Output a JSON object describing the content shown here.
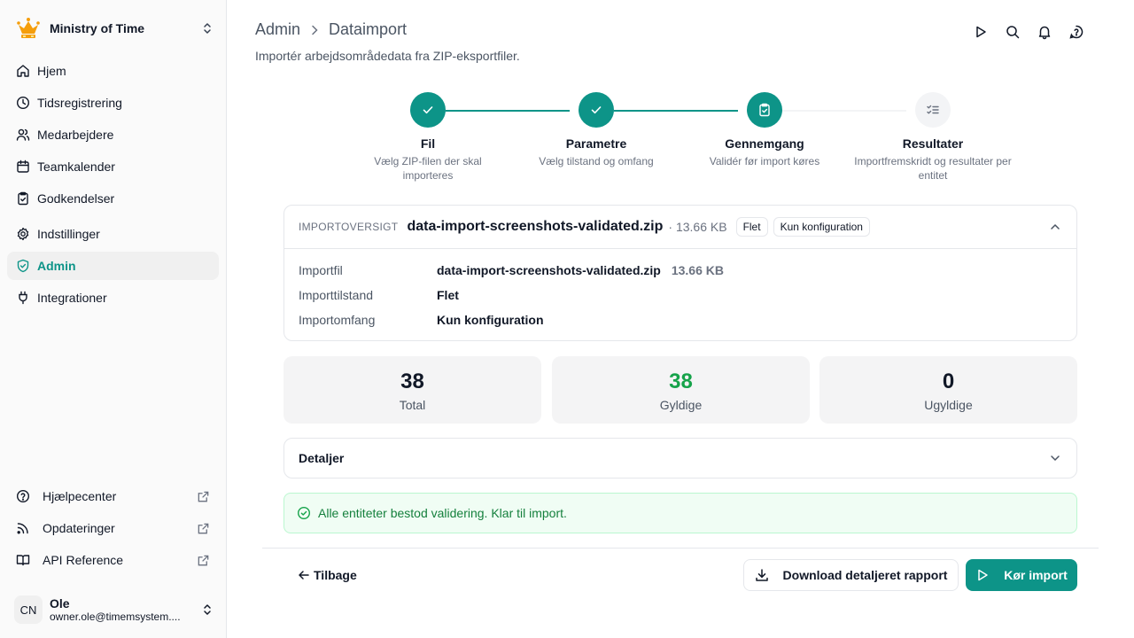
{
  "colors": {
    "accent": "#0d9488",
    "success": "#16a34a",
    "muted": "#6b7280",
    "inactive_step": "#f3f4f6"
  },
  "org": {
    "name": "Ministry of Time"
  },
  "nav": [
    {
      "label": "Hjem",
      "icon": "home-icon"
    },
    {
      "label": "Tidsregistrering",
      "icon": "clock-icon"
    },
    {
      "label": "Medarbejdere",
      "icon": "users-icon"
    },
    {
      "label": "Teamkalender",
      "icon": "calendar-icon"
    },
    {
      "label": "Godkendelser",
      "icon": "clipboard-check-icon"
    },
    {
      "label": "Indstillinger",
      "icon": "gear-icon"
    },
    {
      "label": "Admin",
      "icon": "shield-check-icon",
      "active": true
    },
    {
      "label": "Integrationer",
      "icon": "plug-icon"
    }
  ],
  "bottom_links": [
    {
      "label": "Hjælpecenter",
      "icon": "help-circle-icon"
    },
    {
      "label": "Opdateringer",
      "icon": "rss-icon"
    },
    {
      "label": "API Reference",
      "icon": "book-icon"
    }
  ],
  "user": {
    "initials": "CN",
    "name": "Ole",
    "email": "owner.ole@timemsystem...."
  },
  "breadcrumb": {
    "parent": "Admin",
    "current": "Dataimport"
  },
  "subtitle": "Importér arbejdsområdedata fra ZIP-eksportfiler.",
  "steps": [
    {
      "title": "Fil",
      "desc": "Vælg ZIP-filen der skal importeres",
      "state": "done"
    },
    {
      "title": "Parametre",
      "desc": "Vælg tilstand og omfang",
      "state": "done"
    },
    {
      "title": "Gennemgang",
      "desc": "Validér før import køres",
      "state": "current"
    },
    {
      "title": "Resultater",
      "desc": "Importfremskridt og resultater per entitet",
      "state": "pending"
    }
  ],
  "overview": {
    "caption": "IMPORTOVERSIGT",
    "file_name": "data-import-screenshots-validated.zip",
    "file_size_inline": "· 13.66 KB",
    "badge_mode": "Flet",
    "badge_scope": "Kun konfiguration",
    "rows": {
      "file_label": "Importfil",
      "file_value": "data-import-screenshots-validated.zip",
      "file_size": "13.66 KB",
      "mode_label": "Importtilstand",
      "mode_value": "Flet",
      "scope_label": "Importomfang",
      "scope_value": "Kun konfiguration"
    }
  },
  "stats": [
    {
      "value": "38",
      "label": "Total",
      "color": "#111827"
    },
    {
      "value": "38",
      "label": "Gyldige",
      "color": "#16a34a"
    },
    {
      "value": "0",
      "label": "Ugyldige",
      "color": "#111827"
    }
  ],
  "details": {
    "title": "Detaljer"
  },
  "validation_message": "Alle entiteter bestod validering. Klar til import.",
  "footer": {
    "back": "Tilbage",
    "download": "Download detaljeret rapport",
    "run": "Kør import"
  }
}
